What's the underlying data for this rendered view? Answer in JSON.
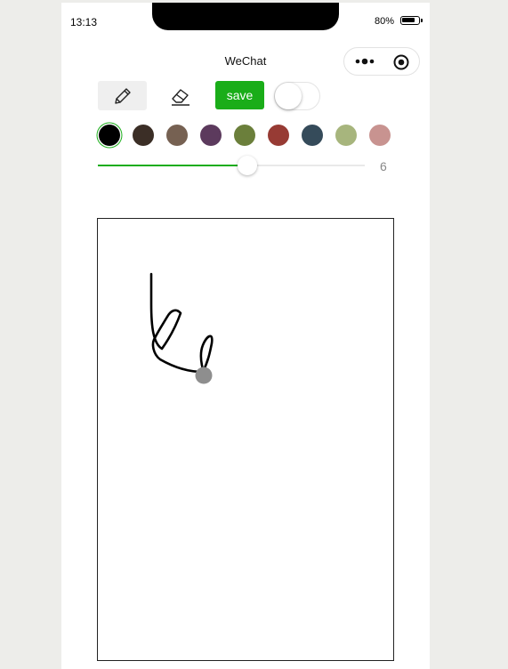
{
  "status_bar": {
    "time": "13:13",
    "battery_percent": "80%",
    "battery_level": 0.8
  },
  "nav": {
    "title": "WeChat",
    "capsule_icons": [
      "more-dots-icon",
      "target-icon"
    ]
  },
  "toolbar": {
    "pencil_icon": "pencil-icon",
    "eraser_icon": "eraser-icon",
    "save_label": "save",
    "toggle_on": false
  },
  "colors": {
    "accent": "#1aad19",
    "swatches": [
      "#000000",
      "#3b2e26",
      "#766152",
      "#5c3a5d",
      "#6b7f3b",
      "#973b34",
      "#354b5a",
      "#a7b57d",
      "#c89390"
    ],
    "selected_index": 0
  },
  "brush": {
    "size_label": "6",
    "slider_fraction": 0.56
  },
  "canvas": {
    "stroke_color": "#000000",
    "cursor_color": "#8e8e8e"
  }
}
